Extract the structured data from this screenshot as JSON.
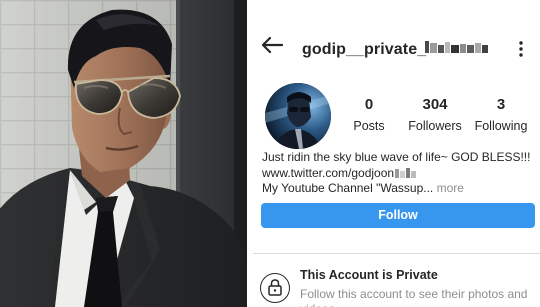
{
  "header": {
    "username": "godip__private_"
  },
  "profile": {
    "stats": [
      {
        "value": "0",
        "label": "Posts"
      },
      {
        "value": "304",
        "label": "Followers"
      },
      {
        "value": "3",
        "label": "Following"
      }
    ],
    "bio": {
      "line1": "Just ridin the sky blue wave of life~ GOD BLESS!!!",
      "link": "www.twitter.com/godjoon",
      "line3": "My Youtube Channel \"Wassup...",
      "more": " more"
    },
    "follow_label": "Follow"
  },
  "privacy": {
    "title": "This Account is Private",
    "description": "Follow this account to see their photos and videos."
  },
  "colors": {
    "follow_button": "#3797ef",
    "text_primary": "#262626",
    "text_secondary": "#8e8e8e",
    "separator": "#dbdbdb"
  },
  "icons": [
    "back-arrow-icon",
    "kebab-menu-icon",
    "lock-icon"
  ]
}
